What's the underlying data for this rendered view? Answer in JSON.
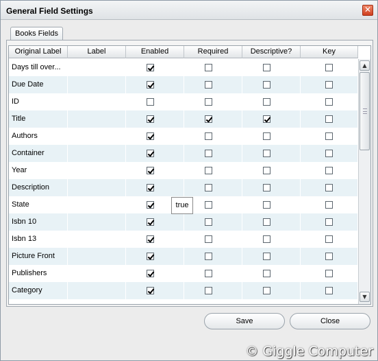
{
  "window": {
    "title": "General Field Settings",
    "close_glyph": "✕"
  },
  "tabs": [
    {
      "label": "Books Fields"
    }
  ],
  "grid": {
    "columns": [
      "Original Label",
      "Label",
      "Enabled",
      "Required",
      "Descriptive?",
      "Key"
    ],
    "rows": [
      {
        "original_label": "Days till over...",
        "label": "",
        "enabled": true,
        "required": false,
        "descriptive": false,
        "key": false
      },
      {
        "original_label": "Due Date",
        "label": "",
        "enabled": true,
        "required": false,
        "descriptive": false,
        "key": false
      },
      {
        "original_label": "ID",
        "label": "",
        "enabled": false,
        "required": false,
        "descriptive": false,
        "key": false
      },
      {
        "original_label": "Title",
        "label": "",
        "enabled": true,
        "required": true,
        "descriptive": true,
        "key": false
      },
      {
        "original_label": "Authors",
        "label": "",
        "enabled": true,
        "required": false,
        "descriptive": false,
        "key": false
      },
      {
        "original_label": "Container",
        "label": "",
        "enabled": true,
        "required": false,
        "descriptive": false,
        "key": false
      },
      {
        "original_label": "Year",
        "label": "",
        "enabled": true,
        "required": false,
        "descriptive": false,
        "key": false
      },
      {
        "original_label": "Description",
        "label": "",
        "enabled": true,
        "required": false,
        "descriptive": false,
        "key": false
      },
      {
        "original_label": "State",
        "label": "",
        "enabled": true,
        "required": false,
        "descriptive": false,
        "key": false
      },
      {
        "original_label": "Isbn 10",
        "label": "",
        "enabled": true,
        "required": false,
        "descriptive": false,
        "key": false
      },
      {
        "original_label": "Isbn 13",
        "label": "",
        "enabled": true,
        "required": false,
        "descriptive": false,
        "key": false
      },
      {
        "original_label": "Picture Front",
        "label": "",
        "enabled": true,
        "required": false,
        "descriptive": false,
        "key": false
      },
      {
        "original_label": "Publishers",
        "label": "",
        "enabled": true,
        "required": false,
        "descriptive": false,
        "key": false
      },
      {
        "original_label": "Category",
        "label": "",
        "enabled": true,
        "required": false,
        "descriptive": false,
        "key": false
      },
      {
        "original_label": "",
        "label": "",
        "enabled": true,
        "required": false,
        "descriptive": false,
        "key": false
      }
    ],
    "tooltip": "true",
    "scroll_up_glyph": "▲",
    "scroll_down_glyph": "▼"
  },
  "buttons": {
    "save_label": "Save",
    "close_label": "Close"
  },
  "watermark": "© Giggle Computer"
}
